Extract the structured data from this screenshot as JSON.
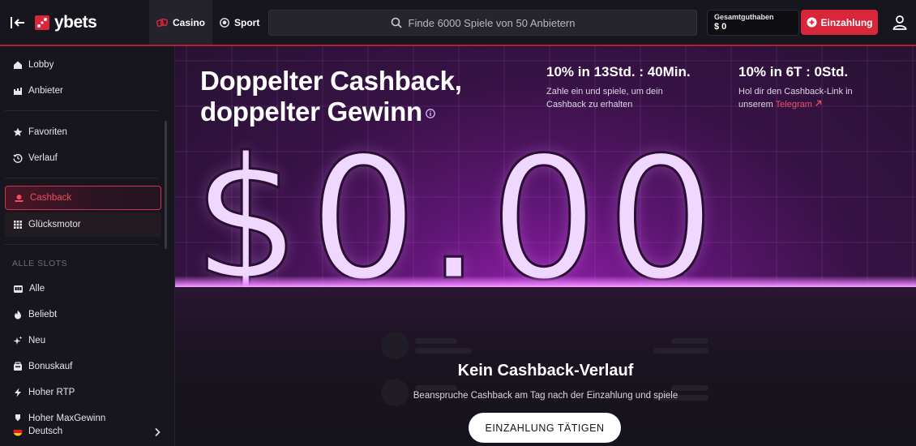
{
  "header": {
    "logo_text": "ybets",
    "tabs": [
      {
        "label": "Casino",
        "icon": "casino-icon",
        "active": true
      },
      {
        "label": "Sport",
        "icon": "sport-ball-icon",
        "active": false
      }
    ],
    "search_placeholder": "Finde 6000 Spiele von 50 Anbietern",
    "balance_label": "Gesamtguthaben",
    "balance_value": "$ 0",
    "deposit_label": "Einzahlung",
    "accent_color": "#d8263a"
  },
  "sidebar": {
    "items": [
      {
        "label": "Lobby",
        "icon": "home-icon"
      },
      {
        "label": "Anbieter",
        "icon": "providers-icon"
      },
      {
        "label": "Favoriten",
        "icon": "star-icon"
      },
      {
        "label": "Verlauf",
        "icon": "history-icon"
      },
      {
        "label": "Cashback",
        "icon": "cashback-icon",
        "active": true
      },
      {
        "label": "Glücksmotor",
        "icon": "grid-icon"
      }
    ],
    "section_title": "ALLE SLOTS",
    "slots": [
      {
        "label": "Alle",
        "icon": "slot-machine-icon"
      },
      {
        "label": "Beliebt",
        "icon": "fire-icon"
      },
      {
        "label": "Neu",
        "icon": "sparkle-icon"
      },
      {
        "label": "Bonuskauf",
        "icon": "bonus-icon"
      },
      {
        "label": "Hoher RTP",
        "icon": "lightning-icon"
      },
      {
        "label": "Hoher MaxGewinn",
        "icon": "trophy-icon"
      }
    ],
    "language": "Deutsch"
  },
  "hero": {
    "title_line1": "Doppelter Cashback,",
    "title_line2": "doppelter Gewinn",
    "stat1_title": "10% in 13Std. : 40Min.",
    "stat1_desc_line1": "Zahle ein und spiele, um dein",
    "stat1_desc_line2": "Cashback zu erhalten",
    "stat2_title": "10% in 6T : 0Std.",
    "stat2_desc_line1": "Hol dir den Cashback-Link in",
    "stat2_desc_prefix": "unserem",
    "stat2_link": "Telegram",
    "amount": "$0.00"
  },
  "empty_state": {
    "title": "Kein Cashback-Verlauf",
    "description": "Beanspruche Cashback am Tag nach der Einzahlung und spiele",
    "button": "EINZAHLUNG TÄTIGEN"
  }
}
